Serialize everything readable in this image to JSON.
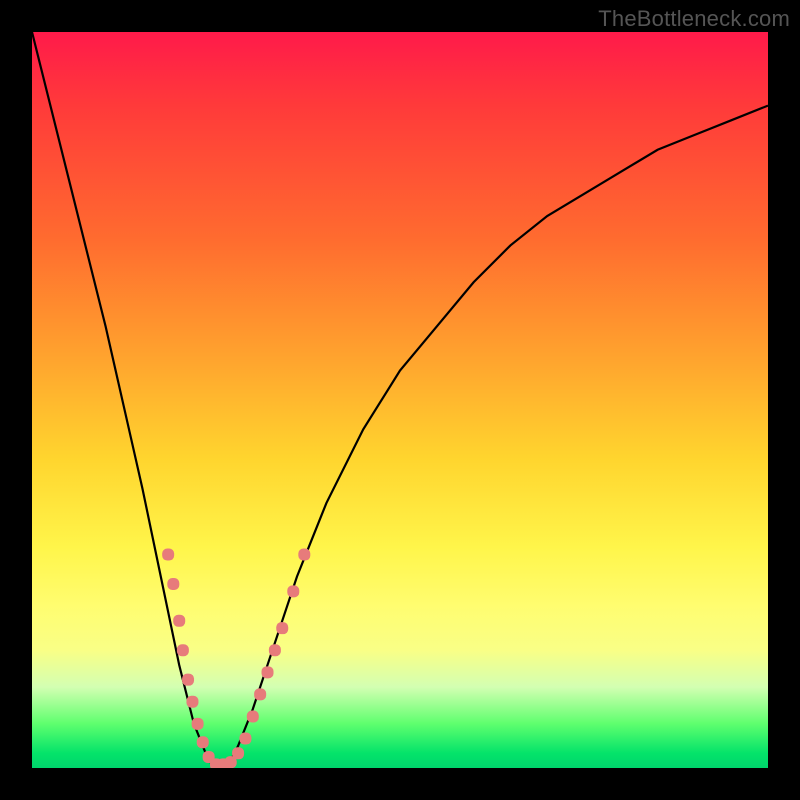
{
  "attribution": "TheBottleneck.com",
  "chart_data": {
    "type": "line",
    "title": "",
    "xlabel": "",
    "ylabel": "",
    "xlim": [
      0,
      100
    ],
    "ylim": [
      0,
      100
    ],
    "grid": false,
    "legend": false,
    "series": [
      {
        "name": "bottleneck-curve",
        "x": [
          0,
          5,
          10,
          15,
          17.5,
          20,
          22,
          24,
          25,
          26,
          27,
          28,
          30,
          32,
          34,
          36,
          38,
          40,
          45,
          50,
          55,
          60,
          65,
          70,
          75,
          80,
          85,
          90,
          95,
          100
        ],
        "y": [
          100,
          80,
          60,
          38,
          26,
          14,
          6,
          1,
          0,
          0,
          1,
          3,
          8,
          14,
          20,
          26,
          31,
          36,
          46,
          54,
          60,
          66,
          71,
          75,
          78,
          81,
          84,
          86,
          88,
          90
        ]
      }
    ],
    "markers": {
      "name": "highlighted-points",
      "color": "#e77b7b",
      "points": [
        {
          "x": 18.5,
          "y": 29
        },
        {
          "x": 19.2,
          "y": 25
        },
        {
          "x": 20.0,
          "y": 20
        },
        {
          "x": 20.5,
          "y": 16
        },
        {
          "x": 21.2,
          "y": 12
        },
        {
          "x": 21.8,
          "y": 9
        },
        {
          "x": 22.5,
          "y": 6
        },
        {
          "x": 23.2,
          "y": 3.5
        },
        {
          "x": 24.0,
          "y": 1.5
        },
        {
          "x": 25.0,
          "y": 0.5
        },
        {
          "x": 26.0,
          "y": 0.5
        },
        {
          "x": 27.0,
          "y": 0.8
        },
        {
          "x": 28.0,
          "y": 2
        },
        {
          "x": 29.0,
          "y": 4
        },
        {
          "x": 30.0,
          "y": 7
        },
        {
          "x": 31.0,
          "y": 10
        },
        {
          "x": 32.0,
          "y": 13
        },
        {
          "x": 33.0,
          "y": 16
        },
        {
          "x": 34.0,
          "y": 19
        },
        {
          "x": 35.5,
          "y": 24
        },
        {
          "x": 37.0,
          "y": 29
        }
      ]
    },
    "background_gradient": {
      "orientation": "vertical",
      "stops": [
        {
          "pos": 0.0,
          "color": "#ff1a4a"
        },
        {
          "pos": 0.1,
          "color": "#ff3a3a"
        },
        {
          "pos": 0.28,
          "color": "#ff6b2f"
        },
        {
          "pos": 0.45,
          "color": "#ffa62e"
        },
        {
          "pos": 0.58,
          "color": "#ffd52e"
        },
        {
          "pos": 0.7,
          "color": "#fff54a"
        },
        {
          "pos": 0.78,
          "color": "#fffd70"
        },
        {
          "pos": 0.84,
          "color": "#f9ff86"
        },
        {
          "pos": 0.89,
          "color": "#d3ffb2"
        },
        {
          "pos": 0.94,
          "color": "#5eff6e"
        },
        {
          "pos": 0.98,
          "color": "#04e36a"
        },
        {
          "pos": 1.0,
          "color": "#00d56c"
        }
      ]
    }
  }
}
